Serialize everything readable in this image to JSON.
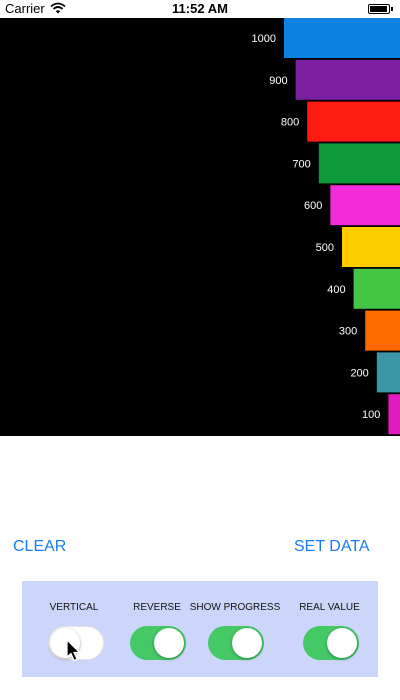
{
  "status_bar": {
    "carrier": "Carrier",
    "time": "11:52 AM",
    "icons": [
      "wifi-icon",
      "battery-icon"
    ]
  },
  "chart_data": {
    "type": "bar",
    "orientation": "horizontal-right-aligned",
    "categories": [
      "1000",
      "900",
      "800",
      "700",
      "600",
      "500",
      "400",
      "300",
      "200",
      "100"
    ],
    "values": [
      1000,
      900,
      800,
      700,
      600,
      500,
      400,
      300,
      200,
      100
    ],
    "colors": [
      "#0a84e0",
      "#7a1fa0",
      "#ff1a12",
      "#0e9a3a",
      "#f52ad9",
      "#ffcc00",
      "#44c644",
      "#ff6a00",
      "#3d96a6",
      "#e01cc0"
    ],
    "background": "#000000",
    "label_color": "#ffffff",
    "title": "",
    "xlabel": "",
    "ylabel": ""
  },
  "buttons": {
    "clear": "CLEAR",
    "set_data": "SET DATA"
  },
  "controls": {
    "vertical": {
      "label": "VERTICAL",
      "on": false
    },
    "reverse": {
      "label": "REVERSE",
      "on": true
    },
    "show_progress": {
      "label": "SHOW PROGRESS",
      "on": true
    },
    "real_value": {
      "label": "REAL VALUE",
      "on": true
    },
    "panel_color": "#ccd6fa",
    "switch_on_color": "#45c866"
  }
}
